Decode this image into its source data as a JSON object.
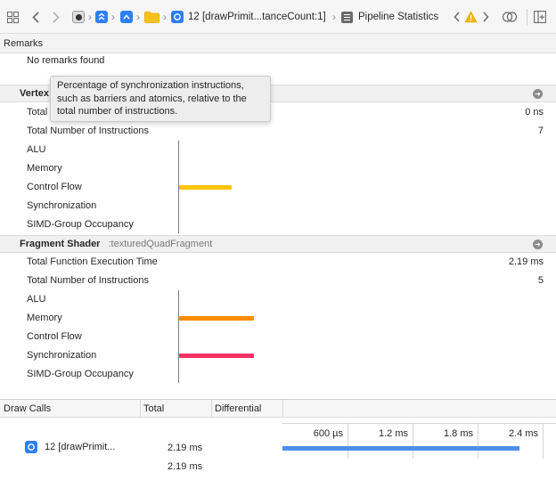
{
  "toolbar": {
    "breadcrumb_draw_call": "12 [drawPrimit...tanceCount:1]",
    "breadcrumb_page": "Pipeline Statistics"
  },
  "remarks": {
    "header": "Remarks",
    "message": "No remarks found"
  },
  "tooltip": {
    "text": "Percentage of synchronization instructions, such as barriers and atomics, relative to the total number of instructions."
  },
  "vertex_shader": {
    "title": "Vertex",
    "rows": [
      {
        "label": "Total",
        "value": "0 ns"
      },
      {
        "label": "Total Number of Instructions",
        "value": "7"
      },
      {
        "label": "ALU"
      },
      {
        "label": "Memory"
      },
      {
        "label": "Control Flow"
      },
      {
        "label": "Synchronization"
      },
      {
        "label": "SIMD-Group Occupancy"
      }
    ],
    "bars": {
      "alu": 0,
      "memory": 0,
      "control_flow": 0.22,
      "synchronization": 0
    }
  },
  "fragment_shader": {
    "title": "Fragment Shader",
    "function_name": ":texturedQuadFragment",
    "rows": [
      {
        "label": "Total Function Execution Time",
        "value": "2.19 ms"
      },
      {
        "label": "Total Number of Instructions",
        "value": "5"
      },
      {
        "label": "ALU"
      },
      {
        "label": "Memory"
      },
      {
        "label": "Control Flow"
      },
      {
        "label": "Synchronization"
      },
      {
        "label": "SIMD-Group Occupancy"
      }
    ],
    "bars": {
      "alu": 0,
      "memory": 0.31,
      "control_flow": 0,
      "synchronization": 0.31
    }
  },
  "draw_calls": {
    "columns": [
      "Draw Calls",
      "Total",
      "Differential"
    ],
    "rows": [
      {
        "name": "12 [drawPrimit...",
        "total": "2.19 ms"
      }
    ],
    "summary_total": "2.19 ms",
    "timeline_ticks": [
      "600 µs",
      "1.2 ms",
      "1.8 ms",
      "2.4 ms"
    ],
    "timeline_bar_ms": 2.19
  },
  "colors": {
    "control_flow": "#fbc400",
    "memory": "#fa8c00",
    "synchronization": "#f53264",
    "timeline": "#4c8ff0",
    "accent_blue": "#2d7ff9",
    "warning": "#f7b500"
  }
}
